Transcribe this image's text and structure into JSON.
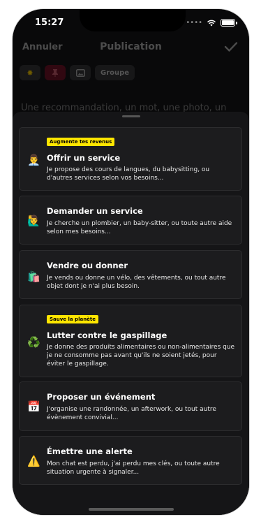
{
  "status": {
    "time": "15:27"
  },
  "nav": {
    "cancel": "Annuler",
    "title": "Publication"
  },
  "toolbar": {
    "group_label": "Groupe"
  },
  "compose": {
    "placeholder": "Une recommandation, un mot, une photo, un"
  },
  "options": [
    {
      "badge": "Augmente tes revenus",
      "icon": "👨‍💼",
      "icon_name": "service-worker-icon",
      "title": "Offrir un service",
      "desc": "Je propose des cours de langues, du babysitting, ou d'autres services selon vos besoins..."
    },
    {
      "badge": "",
      "icon": "🙋‍♂️",
      "icon_name": "raising-hand-icon",
      "title": "Demander un service",
      "desc": "Je cherche un plombier, un baby-sitter, ou toute autre aide selon mes besoins..."
    },
    {
      "badge": "",
      "icon": "🛍️",
      "icon_name": "shopping-bags-icon",
      "title": "Vendre ou donner",
      "desc": "Je vends ou donne un vélo, des vêtements, ou tout autre objet dont je n'ai plus besoin."
    },
    {
      "badge": "Sauve la planète",
      "icon": "♻️",
      "icon_name": "recycle-icon",
      "title": "Lutter contre le gaspillage",
      "desc": "Je donne des produits alimentaires ou non-alimentaires que je ne consomme pas avant qu'ils ne soient jetés, pour éviter le gaspillage."
    },
    {
      "badge": "",
      "icon": "📅",
      "icon_name": "calendar-icon",
      "title": "Proposer un événement",
      "desc": "J'organise une randonnée, un afterwork, ou tout autre évènement convivial..."
    },
    {
      "badge": "",
      "icon": "⚠️",
      "icon_name": "warning-icon",
      "title": "Émettre une alerte",
      "desc": "Mon chat est perdu, j'ai perdu mes clés, ou toute autre situation urgente à signaler..."
    }
  ],
  "colors": {
    "badge": "#ffe600",
    "background": "#111113",
    "card": "#1c1c1e",
    "active_chip": "#5a1020"
  }
}
